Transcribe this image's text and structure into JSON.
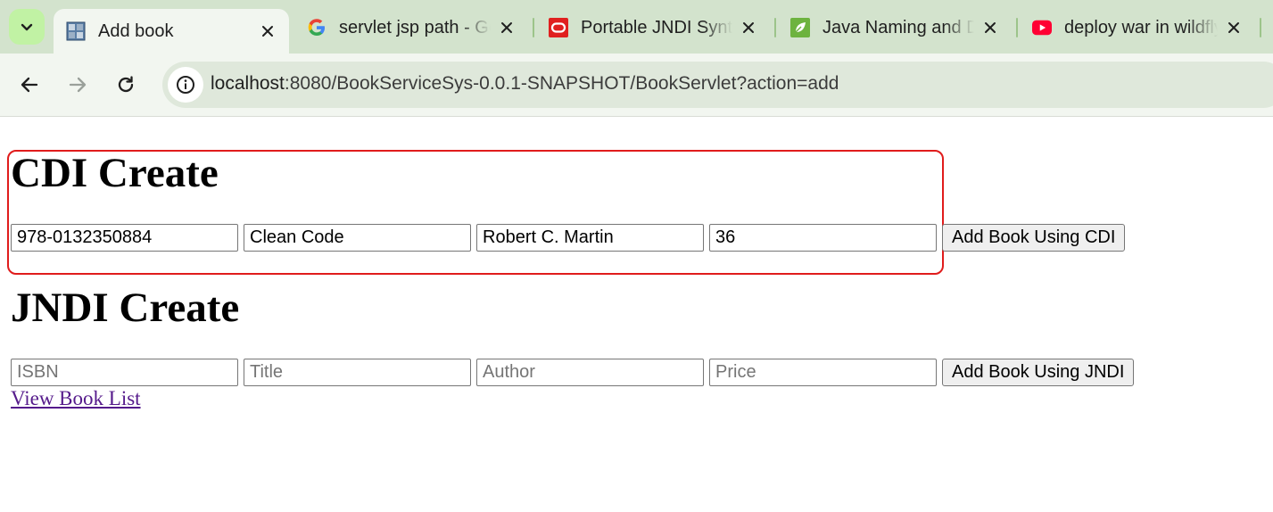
{
  "browser": {
    "tabs": [
      {
        "title": "Add book",
        "favicon": "grid-favicon-icon",
        "active": true
      },
      {
        "title": "servlet jsp path - Google",
        "favicon": "google-icon",
        "active": false
      },
      {
        "title": "Portable JNDI Syntax",
        "favicon": "oracle-icon",
        "active": false
      },
      {
        "title": "Java Naming and Directory",
        "favicon": "spring-leaf-icon",
        "active": false
      },
      {
        "title": "deploy war in wildfly",
        "favicon": "youtube-icon",
        "active": false
      }
    ],
    "url": {
      "host": "localhost",
      "rest": ":8080/BookServiceSys-0.0.1-SNAPSHOT/BookServlet?action=add"
    }
  },
  "cdi": {
    "heading": "CDI Create",
    "isbn_value": "978-0132350884",
    "title_value": "Clean Code",
    "author_value": "Robert C. Martin",
    "price_value": "36",
    "button": "Add Book Using CDI"
  },
  "jndi": {
    "heading": "JNDI Create",
    "isbn_placeholder": "ISBN",
    "title_placeholder": "Title",
    "author_placeholder": "Author",
    "price_placeholder": "Price",
    "button": "Add Book Using JNDI"
  },
  "links": {
    "view_list": "View Book List"
  },
  "colors": {
    "tabstrip": "#d3e3cd",
    "toolbar": "#f2f6f0",
    "highlight": "#e01c1c",
    "visited_link": "#551a8b"
  }
}
